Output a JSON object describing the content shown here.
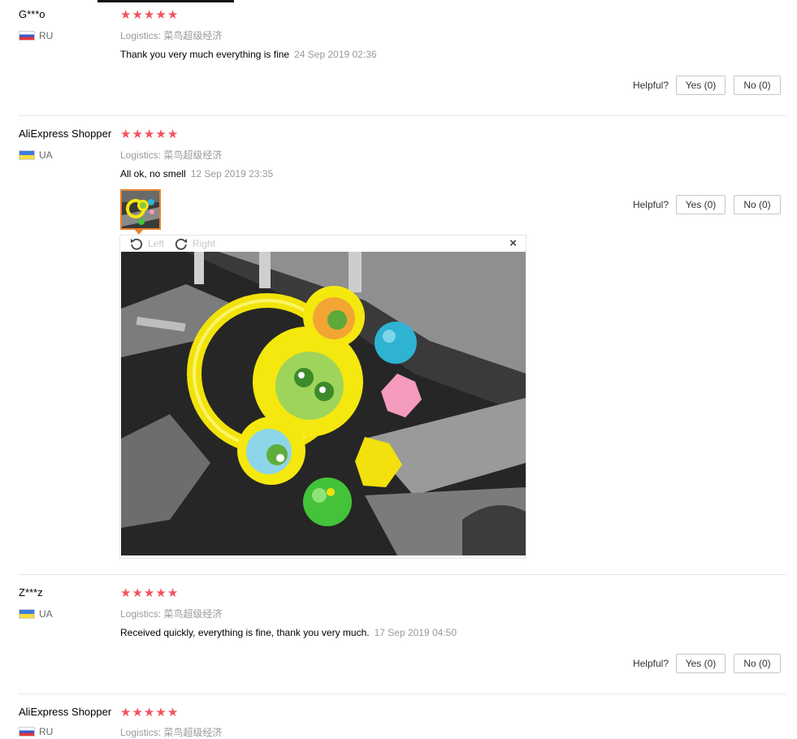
{
  "reviews": [
    {
      "user": "G***o",
      "country": "RU",
      "flag": "ru",
      "rating": 5,
      "logistics_label": "Logistics:",
      "logistics_value": "菜鸟超级经济",
      "text": "Thank you very much everything is fine",
      "date": "24 Sep 2019 02:36",
      "helpful_label": "Helpful?",
      "yes_label": "Yes (0)",
      "no_label": "No (0)"
    },
    {
      "user": "AliExpress Shopper",
      "country": "UA",
      "flag": "ua",
      "rating": 5,
      "logistics_label": "Logistics:",
      "logistics_value": "菜鸟超级经济",
      "text": "All ok, no smell",
      "date": "12 Sep 2019 23:35",
      "helpful_label": "Helpful?",
      "yes_label": "Yes (0)",
      "no_label": "No (0)"
    },
    {
      "user": "Z***z",
      "country": "UA",
      "flag": "ua",
      "rating": 5,
      "logistics_label": "Logistics:",
      "logistics_value": "菜鸟超级经济",
      "text": "Received quickly, everything is fine, thank you very much.",
      "date": "17 Sep 2019 04:50",
      "helpful_label": "Helpful?",
      "yes_label": "Yes (0)",
      "no_label": "No (0)"
    },
    {
      "user": "AliExpress Shopper",
      "country": "RU",
      "flag": "ru",
      "rating": 5,
      "logistics_label": "Logistics:",
      "logistics_value": "菜鸟超级经济"
    }
  ],
  "viewer": {
    "rotate_left_label": "Left",
    "rotate_right_label": "Right",
    "close_symbol": "×"
  },
  "colors": {
    "star": "#f2525e",
    "thumb_border": "#e6832e",
    "toy_yellow": "#f4e80e"
  }
}
